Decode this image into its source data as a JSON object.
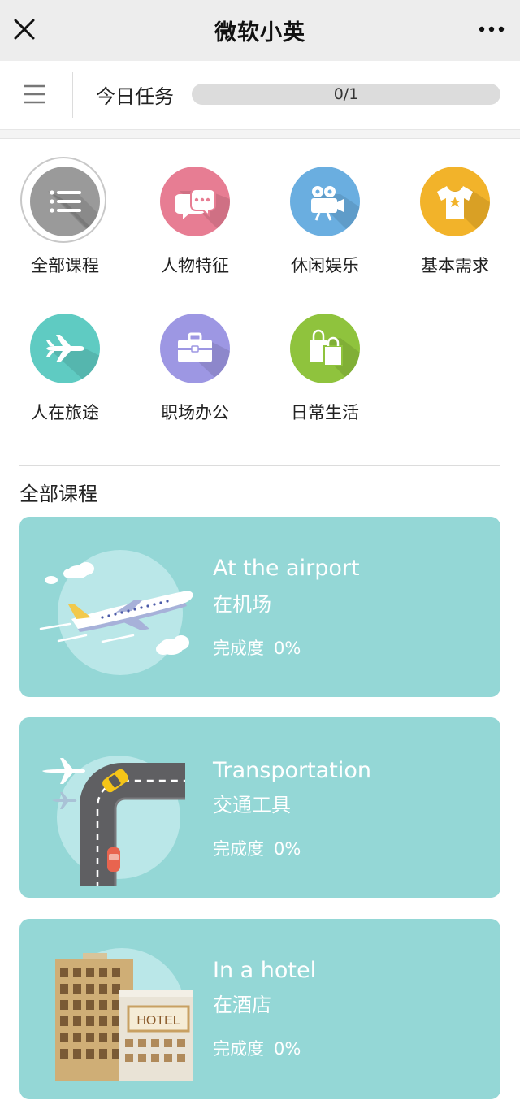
{
  "header": {
    "title": "微软小英"
  },
  "task": {
    "label": "今日任务",
    "progress_text": "0/1",
    "progress_fraction": 0
  },
  "categories": [
    {
      "label": "全部课程",
      "icon": "list-icon",
      "color": "#9a9a9a",
      "selected": true
    },
    {
      "label": "人物特征",
      "icon": "chat-bubbles-icon",
      "color": "#e77d93"
    },
    {
      "label": "休闲娱乐",
      "icon": "movie-camera-icon",
      "color": "#6aaee0"
    },
    {
      "label": "基本需求",
      "icon": "tshirt-icon",
      "color": "#f2b32a"
    },
    {
      "label": "人在旅途",
      "icon": "airplane-icon",
      "color": "#5fcbc2"
    },
    {
      "label": "职场办公",
      "icon": "briefcase-icon",
      "color": "#9d97e3"
    },
    {
      "label": "日常生活",
      "icon": "shopping-bags-icon",
      "color": "#8fc33d"
    }
  ],
  "section": {
    "title": "全部课程"
  },
  "courses": [
    {
      "title_en": "At the airport",
      "title_cn": "在机场",
      "progress_label": "完成度",
      "progress_value": "0%",
      "illustration": "airplane-illustration"
    },
    {
      "title_en": "Transportation",
      "title_cn": "交通工具",
      "progress_label": "完成度",
      "progress_value": "0%",
      "illustration": "road-taxi-illustration"
    },
    {
      "title_en": "In a hotel",
      "title_cn": "在酒店",
      "progress_label": "完成度",
      "progress_value": "0%",
      "illustration": "hotel-illustration"
    }
  ],
  "hotel_sign": "HOTEL",
  "colors": {
    "card_bg": "#94d7d6",
    "topbar_bg": "#ededed",
    "progress_track": "#dcdcdc"
  }
}
